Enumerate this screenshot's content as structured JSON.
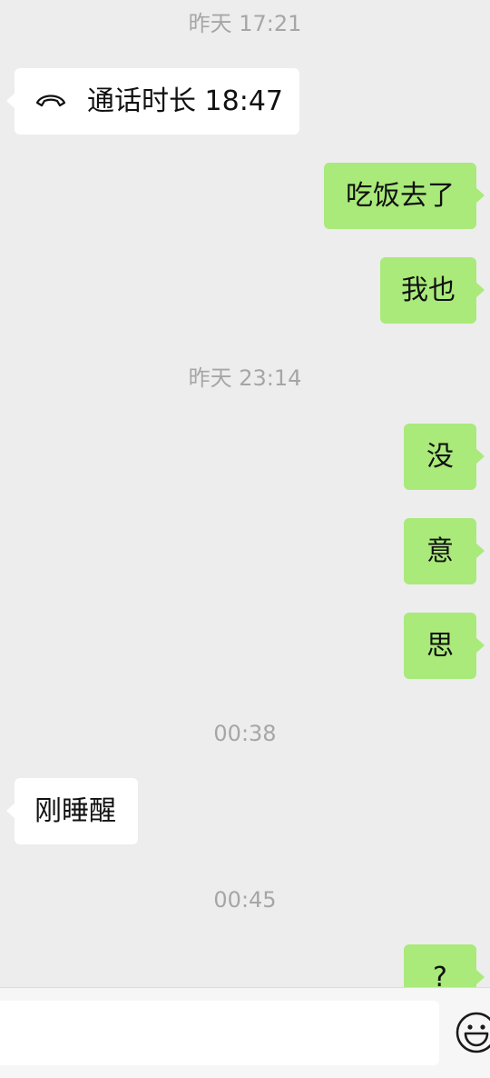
{
  "messages": {
    "ts1": "昨天 17:21",
    "call_text": "通话时长 18:47",
    "out1": "吃饭去了",
    "out2": "我也",
    "ts2": "昨天 23:14",
    "out3": "没",
    "out4": "意",
    "out5": "思",
    "ts3": "00:38",
    "in2": "刚睡醒",
    "ts4": "00:45",
    "out6": "?"
  },
  "input": {
    "value": ""
  },
  "icons": {
    "call": "phone-hangup-icon",
    "emoji": "smiley-face-icon"
  },
  "colors": {
    "background": "#ededed",
    "outgoing_bubble": "#a9ea7a",
    "incoming_bubble": "#ffffff",
    "timestamp": "#a6a6a6"
  }
}
